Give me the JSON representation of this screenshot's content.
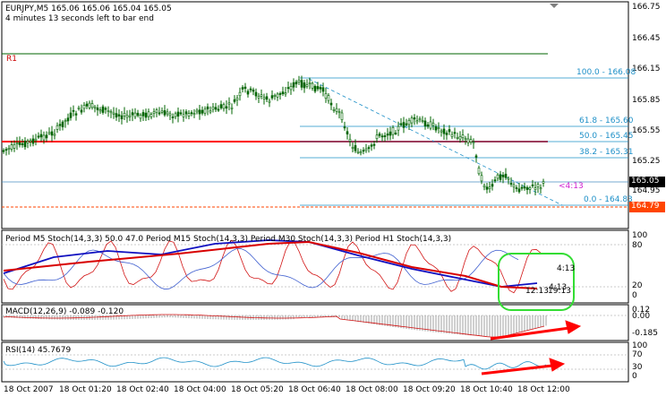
{
  "chart": {
    "symbol_line": "EURJPY,M5  165.06 165.06 165.04 165.05",
    "timer_line": "4 minutes 13 seconds left to bar end",
    "pivot_label": "R1",
    "price_ticks": [
      "166.75",
      "166.45",
      "166.15",
      "165.85",
      "165.55",
      "165.25",
      "164.95"
    ],
    "current_price": "165.05",
    "low_price": "164.79",
    "countdown_tag": "<4:13",
    "fib_levels": [
      "100.0 - 166.08",
      "61.8 - 165.60",
      "50.0 - 165.45",
      "38.2 - 165.31",
      "0.0 - 164.83"
    ],
    "colors": {
      "background": "#ffffff",
      "candles": "#006400",
      "resistance": "#ff0000",
      "pivot_r1": "#006400",
      "fib": "#1e90c8",
      "price_tag": "#000000",
      "low_tag": "#ff4500"
    }
  },
  "stoch": {
    "title": "Period M5  Stoch(14,3,3) 50.0 47.0    Period M15 Stoch(14,3,3)  Period M30 Stoch(14,3,3)   Period H1 Stoch(14,3,3)",
    "ticks": [
      "100",
      "80",
      "20",
      "0"
    ],
    "label_a": "4:13",
    "label_b": "4:13",
    "label_c": "19:13",
    "label_d": "12:13",
    "highlight_color": "#33dd33"
  },
  "macd": {
    "title": "MACD(12,26,9) -0.089 -0.120",
    "ticks": [
      "0.00",
      "-0.185"
    ],
    "extra_tick": "0.12"
  },
  "rsi": {
    "title": "RSI(14) 45.7679",
    "ticks": [
      "100",
      "70",
      "30",
      "0"
    ]
  },
  "time_axis": [
    "18 Oct 2007",
    "18 Oct 01:20",
    "18 Oct 02:40",
    "18 Oct 04:00",
    "18 Oct 05:20",
    "18 Oct 06:40",
    "18 Oct 08:00",
    "18 Oct 09:20",
    "18 Oct 10:40",
    "18 Oct 12:00"
  ],
  "arrows": {
    "color": "#ff0000"
  }
}
